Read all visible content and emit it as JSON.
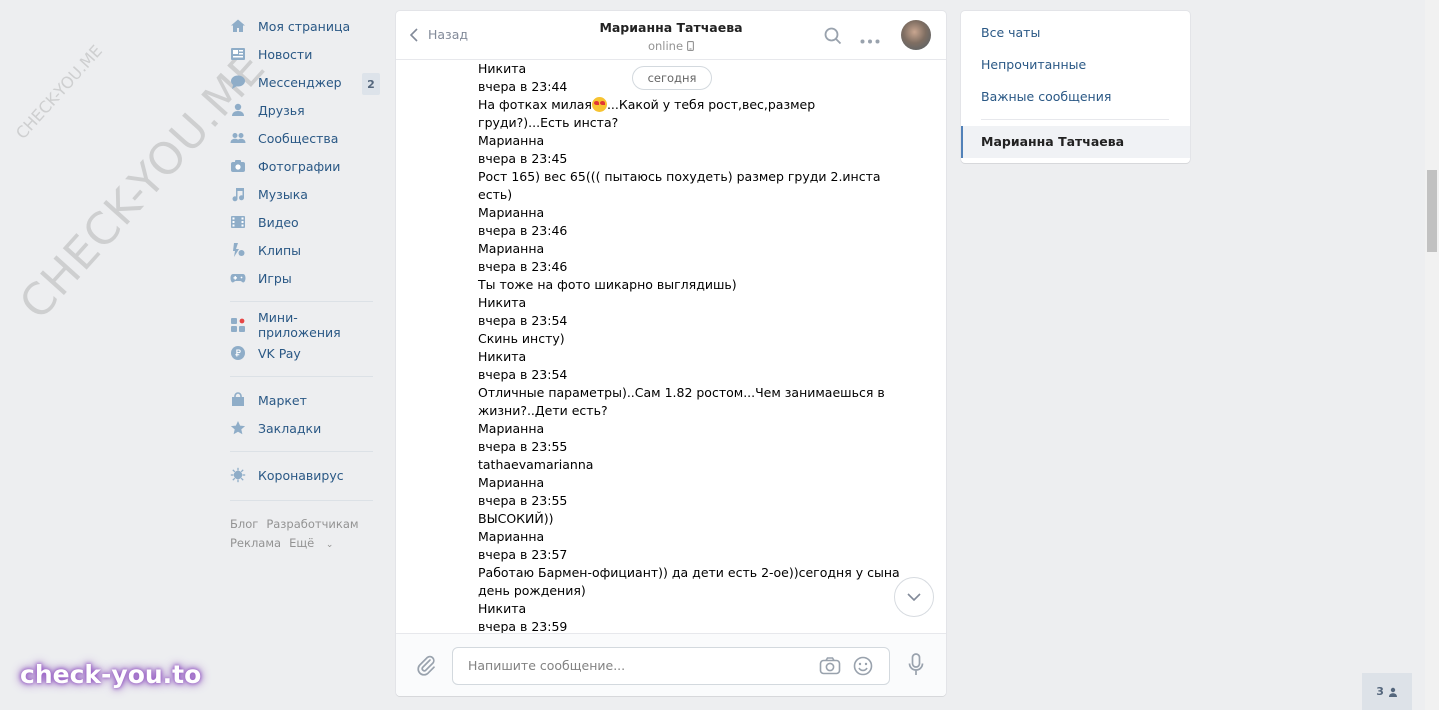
{
  "watermarks": {
    "small": "CHECK-YOU.ME",
    "large": "CHECK-YOU.ME",
    "brand": "check-you.to"
  },
  "nav": {
    "items": [
      {
        "label": "Моя страница",
        "icon": "home-icon"
      },
      {
        "label": "Новости",
        "icon": "news-icon"
      },
      {
        "label": "Мессенджер",
        "icon": "messenger-icon",
        "badge": "2"
      },
      {
        "label": "Друзья",
        "icon": "friends-icon"
      },
      {
        "label": "Сообщества",
        "icon": "communities-icon"
      },
      {
        "label": "Фотографии",
        "icon": "photos-icon"
      },
      {
        "label": "Музыка",
        "icon": "music-icon"
      },
      {
        "label": "Видео",
        "icon": "video-icon"
      },
      {
        "label": "Клипы",
        "icon": "clips-icon"
      },
      {
        "label": "Игры",
        "icon": "games-icon"
      }
    ],
    "apps": [
      {
        "label": "Мини-приложения",
        "icon": "mini-apps-icon"
      },
      {
        "label": "VK Pay",
        "icon": "vkpay-icon"
      }
    ],
    "shop": [
      {
        "label": "Маркет",
        "icon": "market-icon"
      },
      {
        "label": "Закладки",
        "icon": "bookmarks-icon"
      }
    ],
    "extra": [
      {
        "label": "Коронавирус",
        "icon": "coronavirus-icon"
      }
    ],
    "footer": {
      "blog": "Блог",
      "dev": "Разработчикам",
      "ads": "Реклама",
      "more": "Ещё"
    }
  },
  "chat": {
    "back_label": "Назад",
    "peer_name": "Марианна Татчаева",
    "peer_status": "online",
    "date_divider": "сегодня",
    "messages": [
      "Никита",
      "вчера в 23:44",
      "На фотках милая",
      "...Какой у тебя рост,вес,размер",
      "груди?)...Есть инста?",
      "Марианна",
      "вчера в 23:45",
      "Рост 165) вес 65((( пытаюсь похудеть) размер груди 2.инста",
      "есть)",
      "Марианна",
      "вчера в 23:46",
      "Марианна",
      "вчера в 23:46",
      "Ты тоже на фото шикарно выглядишь)",
      "Никита",
      "вчера в 23:54",
      "Скинь инсту)",
      "Никита",
      "вчера в 23:54",
      "Отличные параметры)..Сам 1.82 ростом...Чем занимаешься в",
      "жизни?..Дети есть?",
      "Марианна",
      "вчера в 23:55",
      "tathaevamarianna",
      "Марианна",
      "вчера в 23:55",
      "ВЫСОКИЙ))",
      "Марианна",
      "вчера в 23:57",
      "Работаю Бармен-официант)) да дети есть 2-ое))сегодня у сына",
      "день рождения)",
      "Никита",
      "вчера в 23:59"
    ],
    "composer_placeholder": "Напишите сообщение..."
  },
  "right_panel": {
    "all_chats": "Все чаты",
    "unread": "Непрочитанные",
    "important": "Важные сообщения",
    "active_chat": "Марианна Татчаева"
  },
  "online_counter": "3",
  "colors": {
    "link": "#2a5885",
    "background": "#edeef0",
    "accent": "#5181b8"
  }
}
